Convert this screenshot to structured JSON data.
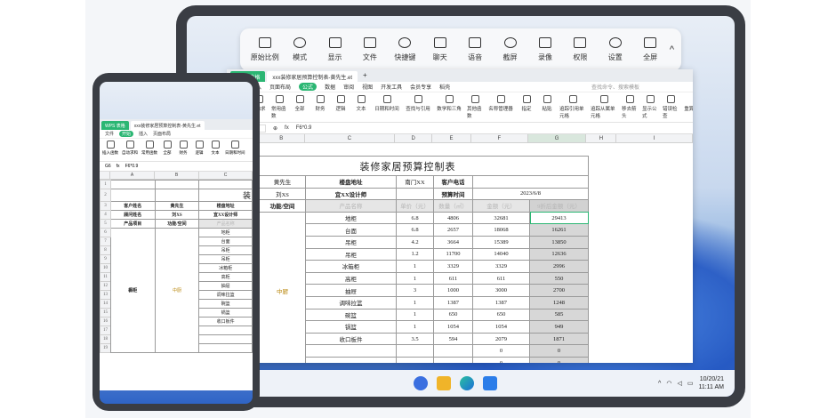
{
  "floatbar": {
    "items": [
      {
        "label": "原始比例",
        "icon": "original-ratio-icon"
      },
      {
        "label": "模式",
        "icon": "mode-grid-icon"
      },
      {
        "label": "显示",
        "icon": "display-icon"
      },
      {
        "label": "文件",
        "icon": "folder-icon"
      },
      {
        "label": "快捷键",
        "icon": "keyboard-icon"
      },
      {
        "label": "聊天",
        "icon": "chat-icon"
      },
      {
        "label": "语音",
        "icon": "phone-icon"
      },
      {
        "label": "截屏",
        "icon": "scissors-icon"
      },
      {
        "label": "录像",
        "icon": "record-icon"
      },
      {
        "label": "权限",
        "icon": "lock-icon"
      },
      {
        "label": "设置",
        "icon": "gear-icon"
      },
      {
        "label": "全屏",
        "icon": "fullscreen-icon"
      }
    ],
    "chevron": "^"
  },
  "taskbar": {
    "time": "11:11 AM",
    "date": "10/20/21"
  },
  "wps": {
    "app_tab": "WPS 表格",
    "doc_tab": "xxx装修家居预算控制表-黄先生.et",
    "plus": "+",
    "menu": [
      "开始",
      "插入",
      "页面布局",
      "公式",
      "数据",
      "审阅",
      "视图",
      "开发工具",
      "会员专享",
      "稻壳"
    ],
    "active_menu": "公式",
    "search": "查找命令、搜索模板",
    "ribbon": [
      "插入函数",
      "自动求和",
      "常用函数",
      "全部",
      "财务",
      "逻辑",
      "文本",
      "日期和时间",
      "查找与引用",
      "数学和三角",
      "其他函数",
      "名称管理器",
      "指定",
      "粘贴",
      "追踪引用单元格",
      "追踪从属单元格",
      "移去箭头",
      "显示公式",
      "错误检查",
      "重算工作簿"
    ],
    "formula_ref": "G6",
    "formula": "F6*0.9",
    "col_headers": [
      "A",
      "B",
      "C",
      "D",
      "E",
      "F",
      "G",
      "H",
      "I"
    ]
  },
  "sheet": {
    "title": "装修家居预算控制表",
    "r2": [
      "客户姓名",
      "黄先生",
      "楼盘地址",
      "南门XX",
      "客户电话",
      ""
    ],
    "r3": [
      "顾问姓名",
      "刘XS",
      "宜XX设计师",
      "",
      "预算时间",
      "2023/6/8"
    ],
    "r4": [
      "产品项目",
      "功能/空间",
      "产品名称",
      "单价（元）",
      "数量（㎡）",
      "金额（元）",
      "9折后金额（元）"
    ],
    "product": "橱柜",
    "space": "中厨",
    "rows": [
      [
        "地柜",
        "6.8",
        "4806",
        "32681",
        "29413"
      ],
      [
        "台面",
        "6.8",
        "2657",
        "18068",
        "16261"
      ],
      [
        "吊柜",
        "4.2",
        "3664",
        "15389",
        "13850"
      ],
      [
        "吊柜",
        "1.2",
        "11700",
        "14040",
        "12636"
      ],
      [
        "冰箱柜",
        "1",
        "3329",
        "3329",
        "2996"
      ],
      [
        "高柜",
        "1",
        "611",
        "611",
        "550"
      ],
      [
        "抽屉",
        "3",
        "1000",
        "3000",
        "2700"
      ],
      [
        "调味拉篮",
        "1",
        "1387",
        "1387",
        "1248"
      ],
      [
        "碗篮",
        "1",
        "650",
        "650",
        "585"
      ],
      [
        "锅篮",
        "1",
        "1054",
        "1054",
        "949"
      ],
      [
        "收口板件",
        "3.5",
        "594",
        "2079",
        "1871"
      ],
      [
        "",
        "",
        "",
        "0",
        "0"
      ],
      [
        "",
        "",
        "",
        "0",
        "0"
      ]
    ]
  },
  "phone": {
    "app_tab": "WPS 表格",
    "doc_tab": "xxx装修家居预算控制表-黄先生.et",
    "menu": [
      "文件",
      "开始",
      "插入",
      "页面布局"
    ],
    "active_menu": "开始",
    "ribbon": [
      "插入函数",
      "自动求和",
      "常用函数",
      "全部",
      "财务",
      "逻辑",
      "文本",
      "日期和时间"
    ],
    "formula_ref": "G6",
    "formula": "F6*0.9",
    "col_headers": [
      "A",
      "B",
      "C"
    ],
    "title_part": "装",
    "r3": [
      "客户姓名",
      "黄先生",
      "楼盘地址"
    ],
    "r4": [
      "顾问姓名",
      "刘XS",
      "宜XX设计师"
    ],
    "r5": [
      "产品项目",
      "功能/空间",
      "产品名称"
    ],
    "items": [
      "地柜",
      "台面",
      "吊柜",
      "吊柜",
      "冰箱柜",
      "高柜",
      "抽屉",
      "调味拉篮",
      "碗篮",
      "锅篮",
      "收口板件"
    ],
    "product": "橱柜",
    "space": "中厨"
  }
}
